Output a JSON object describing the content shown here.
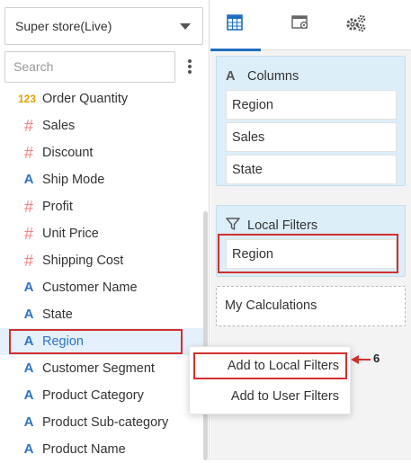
{
  "datasource": {
    "selected": "Super store(Live)"
  },
  "search": {
    "placeholder": "Search"
  },
  "fields": [
    {
      "label": "Order Quantity",
      "type": "number",
      "glyph": "123"
    },
    {
      "label": "Sales",
      "type": "measure",
      "glyph": "#"
    },
    {
      "label": "Discount",
      "type": "measure",
      "glyph": "#"
    },
    {
      "label": "Ship Mode",
      "type": "dimension",
      "glyph": "A"
    },
    {
      "label": "Profit",
      "type": "measure",
      "glyph": "#"
    },
    {
      "label": "Unit Price",
      "type": "measure",
      "glyph": "#"
    },
    {
      "label": "Shipping Cost",
      "type": "measure",
      "glyph": "#"
    },
    {
      "label": "Customer Name",
      "type": "dimension",
      "glyph": "A"
    },
    {
      "label": "State",
      "type": "dimension",
      "glyph": "A"
    },
    {
      "label": "Region",
      "type": "dimension",
      "glyph": "A",
      "selected": true
    },
    {
      "label": "Customer Segment",
      "type": "dimension",
      "glyph": "A"
    },
    {
      "label": "Product Category",
      "type": "dimension",
      "glyph": "A"
    },
    {
      "label": "Product Sub-category",
      "type": "dimension",
      "glyph": "A"
    },
    {
      "label": "Product Name",
      "type": "dimension",
      "glyph": "A"
    }
  ],
  "tabs": [
    {
      "icon": "table-icon",
      "active": true
    },
    {
      "icon": "settings-window-icon",
      "active": false
    },
    {
      "icon": "gears-icon",
      "active": false
    }
  ],
  "columns": {
    "title": "Columns",
    "icon_glyph": "A",
    "items": [
      "Region",
      "Sales",
      "State"
    ]
  },
  "local_filters": {
    "title": "Local Filters",
    "items": [
      "Region"
    ]
  },
  "calculations": {
    "title": "My Calculations"
  },
  "context_menu": {
    "items": [
      "Add to Local Filters",
      "Add to User Filters"
    ]
  },
  "annotation": {
    "step_number": "6"
  },
  "colors": {
    "accent": "#1f6fc0",
    "highlight": "#d32f2f",
    "measure_icon": "#f08080",
    "dimension_icon": "#2f74c0",
    "panel_blue": "#dceef8"
  }
}
